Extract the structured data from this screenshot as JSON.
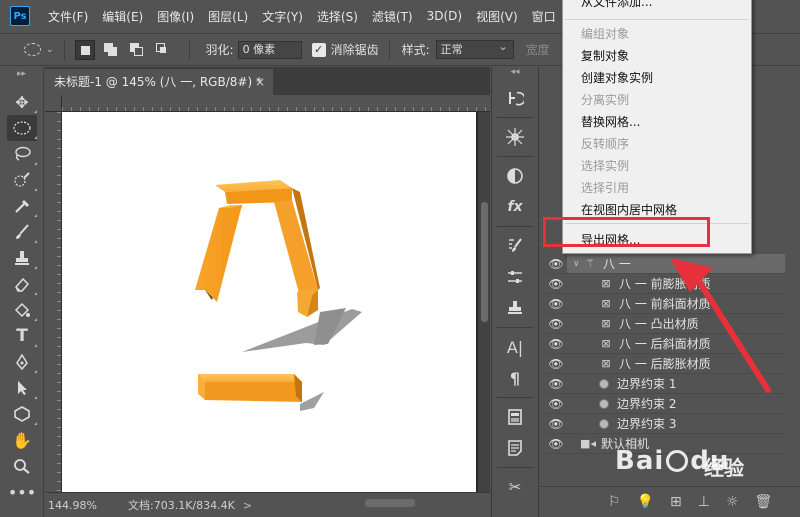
{
  "app": {
    "logo": "Ps",
    "menu": [
      "文件(F)",
      "编辑(E)",
      "图像(I)",
      "图层(L)",
      "文字(Y)",
      "选择(S)",
      "滤镜(T)",
      "3D(D)",
      "视图(V)",
      "窗口"
    ]
  },
  "options": {
    "feather_label": "羽化:",
    "feather_value": "0 像素",
    "antialias_label": "消除锯齿",
    "antialias_checked": true,
    "style_label": "样式:",
    "style_value": "正常",
    "width_label": "宽度"
  },
  "document": {
    "tab_title": "未标题-1 @ 145% (八 一, RGB/8#) *",
    "close": "×"
  },
  "status": {
    "zoom": "144.98%",
    "doc_info": "文档:703.1K/834.4K",
    "arrow": ">"
  },
  "context_menu": {
    "items": [
      {
        "label": "从文件添加...",
        "disabled": false
      },
      {
        "label": "编组对象",
        "disabled": true
      },
      {
        "label": "复制对象",
        "disabled": false
      },
      {
        "label": "创建对象实例",
        "disabled": false
      },
      {
        "label": "分离实例",
        "disabled": true
      },
      {
        "label": "替换网格...",
        "disabled": false
      },
      {
        "label": "反转顺序",
        "disabled": true
      },
      {
        "label": "选择实例",
        "disabled": true
      },
      {
        "label": "选择引用",
        "disabled": true
      },
      {
        "label": "在视图内居中网格",
        "disabled": false
      },
      {
        "label": "导出网格...",
        "disabled": false
      }
    ]
  },
  "scene": {
    "rows": [
      {
        "label": "八 一",
        "type": "mesh"
      },
      {
        "label": "八 一 前膨胀材质",
        "type": "material"
      },
      {
        "label": "八 一 前斜面材质",
        "type": "material"
      },
      {
        "label": "八 一 凸出材质",
        "type": "material"
      },
      {
        "label": "八 一 后斜面材质",
        "type": "material"
      },
      {
        "label": "八 一 后膨胀材质",
        "type": "material"
      },
      {
        "label": "边界约束 1",
        "type": "constraint"
      },
      {
        "label": "边界约束 2",
        "type": "constraint"
      },
      {
        "label": "边界约束 3",
        "type": "constraint"
      },
      {
        "label": "默认相机",
        "type": "camera"
      }
    ]
  },
  "colors": {
    "accent_red": "#e8303a",
    "object_orange": "#f5a623",
    "panel_bg": "#535353"
  },
  "watermark": {
    "brand_a": "Bai",
    "brand_b": "du",
    "brand_c": "经验"
  }
}
